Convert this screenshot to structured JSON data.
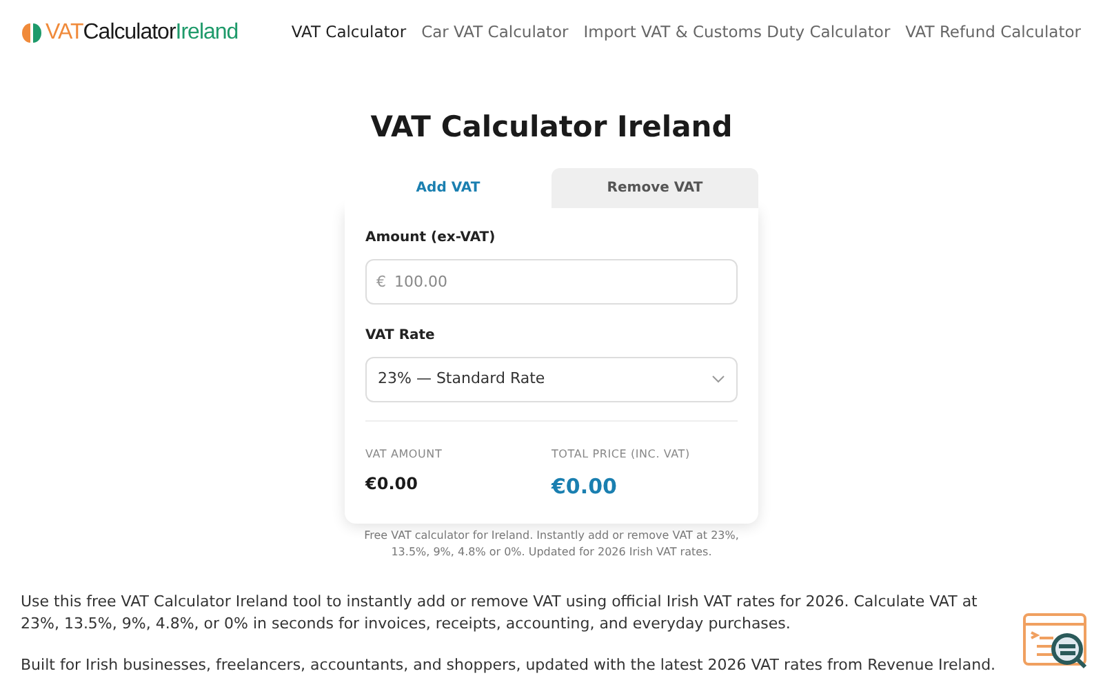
{
  "logo": {
    "parts": [
      {
        "text": "VAT",
        "color": "#f08a3a"
      },
      {
        "text": "Calculator",
        "color": "#1a1a1a"
      },
      {
        "text": "Ireland",
        "color": "#1e9a6a"
      }
    ]
  },
  "nav": [
    {
      "label": "VAT Calculator",
      "selected": true
    },
    {
      "label": "Car VAT Calculator",
      "selected": false
    },
    {
      "label": "Import VAT & Customs Duty Calculator",
      "selected": false
    },
    {
      "label": "VAT Refund Calculator",
      "selected": false
    }
  ],
  "title": "VAT Calculator Ireland",
  "tabs": [
    {
      "label": "Add VAT",
      "selected": true
    },
    {
      "label": "Remove VAT",
      "selected": false
    }
  ],
  "amount": {
    "label": "Amount (ex-VAT)",
    "currency": "€",
    "placeholder": "100.00"
  },
  "rate": {
    "label": "VAT Rate",
    "value": "23% — Standard Rate"
  },
  "results": [
    {
      "label": "VAT AMOUNT",
      "value": "€0.00",
      "highlight": false
    },
    {
      "label": "TOTAL PRICE (INC. VAT)",
      "value": "€0.00",
      "highlight": true
    }
  ],
  "note": "Free VAT calculator for Ireland. Instantly add or remove VAT at 23%, 13.5%, 9%, 4.8% or 0%. Updated for 2026 Irish VAT rates.",
  "paragraphs": [
    "Use this free VAT Calculator Ireland tool to instantly add or remove VAT using official Irish VAT rates for 2026. Calculate VAT at 23%, 13.5%, 9%, 4.8%, or 0% in seconds for invoices, receipts, accounting, and everyday purchases.",
    "Built for Irish businesses, freelancers, accountants, and shoppers, updated with the latest 2026 VAT rates from Revenue Ireland."
  ]
}
